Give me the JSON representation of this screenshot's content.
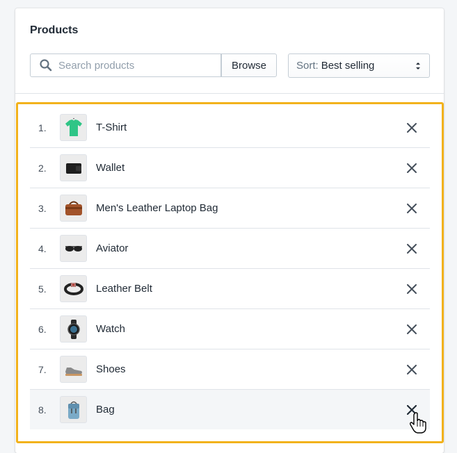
{
  "header": {
    "title": "Products"
  },
  "search": {
    "placeholder": "Search products",
    "value": ""
  },
  "browse": {
    "label": "Browse"
  },
  "sort": {
    "prefix": "Sort:",
    "value": "Best selling"
  },
  "colors": {
    "highlight": "#f2b21c",
    "text": "#212b36",
    "muted": "#919eab"
  },
  "products": [
    {
      "index": "1.",
      "name": "T-Shirt",
      "thumbnail": "tshirt-icon"
    },
    {
      "index": "2.",
      "name": "Wallet",
      "thumbnail": "wallet-icon"
    },
    {
      "index": "3.",
      "name": "Men's Leather Laptop Bag",
      "thumbnail": "laptop-bag-icon"
    },
    {
      "index": "4.",
      "name": "Aviator",
      "thumbnail": "sunglasses-icon"
    },
    {
      "index": "5.",
      "name": "Leather Belt",
      "thumbnail": "belt-icon"
    },
    {
      "index": "6.",
      "name": "Watch",
      "thumbnail": "watch-icon"
    },
    {
      "index": "7.",
      "name": "Shoes",
      "thumbnail": "shoe-icon"
    },
    {
      "index": "8.",
      "name": "Bag",
      "thumbnail": "backpack-icon"
    }
  ]
}
